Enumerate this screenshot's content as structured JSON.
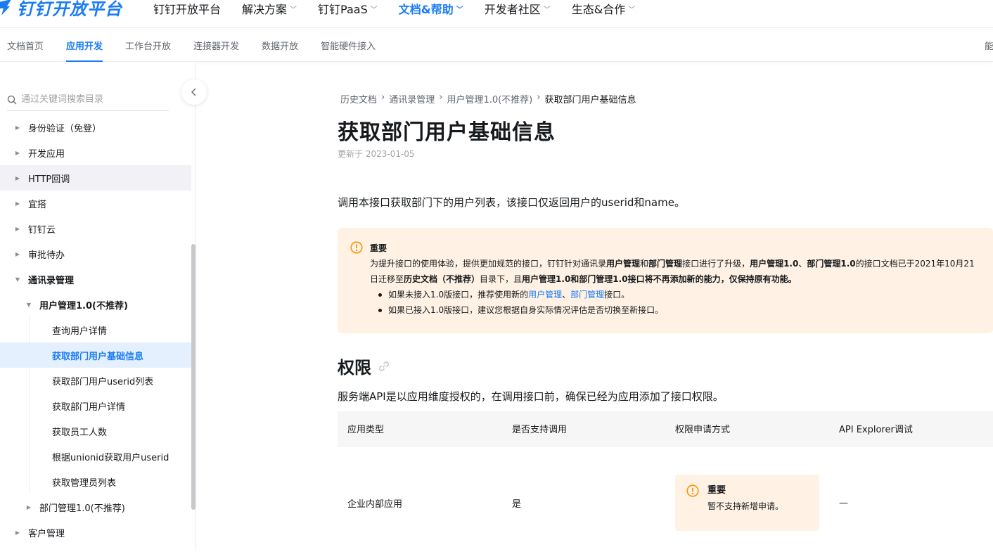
{
  "brand": {
    "logo_text": "钉钉开放平台",
    "accent_color": "#1a7cf5"
  },
  "topnav": {
    "items": [
      {
        "label": "钉钉开放平台",
        "has_dropdown": false,
        "active": false
      },
      {
        "label": "解决方案",
        "has_dropdown": true,
        "active": false
      },
      {
        "label": "钉钉PaaS",
        "has_dropdown": true,
        "active": false
      },
      {
        "label": "文档&帮助",
        "has_dropdown": true,
        "active": true
      },
      {
        "label": "开发者社区",
        "has_dropdown": true,
        "active": false
      },
      {
        "label": "生态&合作",
        "has_dropdown": true,
        "active": false
      }
    ]
  },
  "subnav": {
    "items": [
      "文档首页",
      "应用开发",
      "工作台开放",
      "连接器开发",
      "数据开放",
      "智能硬件接入"
    ],
    "active_index": 1,
    "right_cut_label": "能"
  },
  "sidebar": {
    "search_placeholder": "通过关键词搜索目录",
    "tree": [
      {
        "label": "身份验证（免登）"
      },
      {
        "label": "开发应用"
      },
      {
        "label": "HTTP回调"
      },
      {
        "label": "宜搭"
      },
      {
        "label": "钉钉云"
      },
      {
        "label": "审批待办"
      },
      {
        "label": "通讯录管理"
      },
      {
        "label": "用户管理1.0(不推荐)"
      },
      {
        "label": "查询用户详情"
      },
      {
        "label": "获取部门用户基础信息"
      },
      {
        "label": "获取部门用户userid列表"
      },
      {
        "label": "获取部门用户详情"
      },
      {
        "label": "获取员工人数"
      },
      {
        "label": "根据unionid获取用户userid"
      },
      {
        "label": "获取管理员列表"
      },
      {
        "label": "部门管理1.0(不推荐)"
      },
      {
        "label": "客户管理"
      }
    ]
  },
  "breadcrumb": [
    "历史文档",
    "通讯录管理",
    "用户管理1.0(不推荐)",
    "获取部门用户基础信息"
  ],
  "page": {
    "title": "获取部门用户基础信息",
    "updated": "更新于 2023-01-05",
    "intro": "调用本接口获取部门下的用户列表，该接口仅返回用户的userid和name。"
  },
  "note": {
    "title": "重要",
    "p1_a": "为提升接口的使用体验，提供更加规范的接口，钉钉针对通讯录",
    "p1_b": "用户管理",
    "p1_c": "和",
    "p1_d": "部门管理",
    "p1_e": "接口进行了升级，",
    "p1_f": "用户管理1.0",
    "p1_g": "、",
    "p1_h": "部门管理1.0",
    "p1_i": "的接口文档已于2021年10月21日迁移至",
    "p1_j": "历史文档（不推荐）",
    "p1_k": "目录下，且",
    "p1_l": "用户管理1.0和部门管理1.0接口将不再添加新的能力，仅保持原有功能。",
    "b1_a": "如果未接入1.0版接口，推荐使用新的",
    "b1_link1": "用户管理",
    "b1_sep": "、",
    "b1_link2": "部门管理",
    "b1_b": "接口。",
    "b2": "如果已接入1.0版接口，建议您根据自身实际情况评估是否切换至新接口。"
  },
  "permissions": {
    "title": "权限",
    "desc": "服务端API是以应用维度授权的，在调用接口前，确保已经为应用添加了接口权限。",
    "columns": [
      "应用类型",
      "是否支持调用",
      "权限申请方式",
      "API Explorer调试"
    ],
    "row": {
      "app_type": "企业内部应用",
      "supported": "是",
      "note_title": "重要",
      "note_text": "暂不支持新增申请。",
      "explorer": "—"
    }
  }
}
